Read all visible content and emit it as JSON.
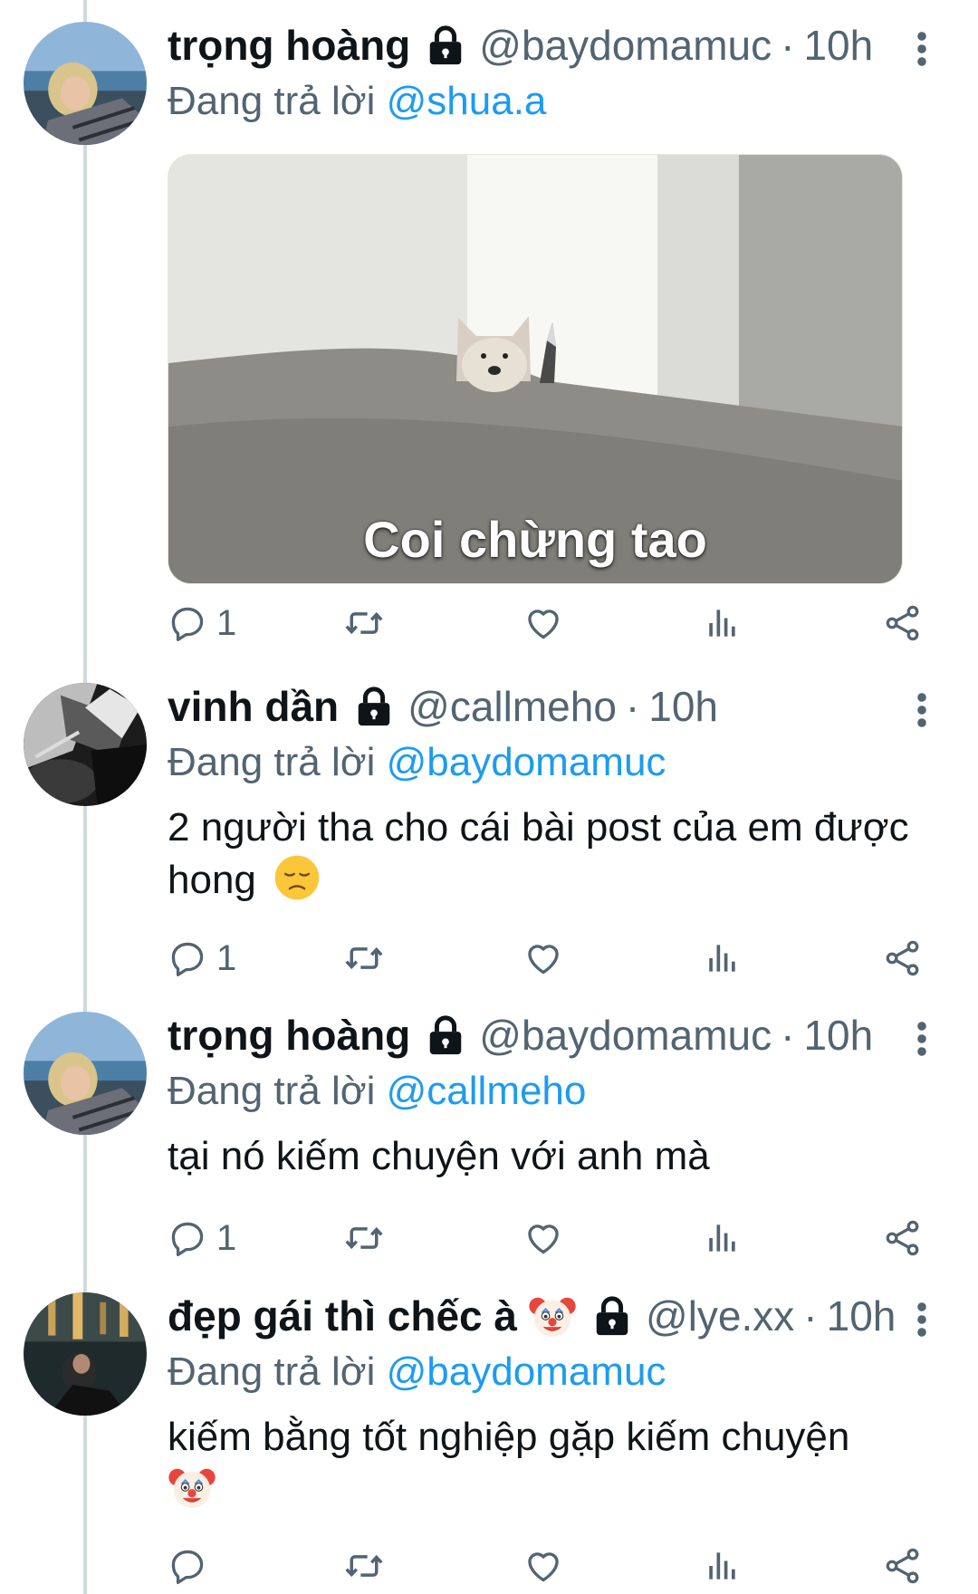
{
  "reply_prefix": "Đang trả lời",
  "colors": {
    "link": "#1d9bf0",
    "secondary": "#536471",
    "text": "#0f1419",
    "thread_line": "#cfd9de"
  },
  "tweets": [
    {
      "name": "trọng hoàng",
      "handle": "@baydomamuc",
      "separator": "·",
      "time": "10h",
      "replying_to": "@shua.a",
      "media_caption": "Coi chừng tao",
      "reply_count": "1",
      "avatar": "avatar-blonde-person-seaside"
    },
    {
      "name": "vinh dần",
      "handle": "@callmeho",
      "separator": "·",
      "time": "10h",
      "replying_to": "@baydomamuc",
      "text": "2 người tha cho cái bài post của em được hong",
      "text_emoji": "disappointed-face-emoji",
      "reply_count": "1",
      "avatar": "avatar-black-white-photo"
    },
    {
      "name": "trọng hoàng",
      "handle": "@baydomamuc",
      "separator": "·",
      "time": "10h",
      "replying_to": "@callmeho",
      "text": "tại nó kiếm chuyện với anh mà",
      "reply_count": "1",
      "avatar": "avatar-blonde-person-seaside"
    },
    {
      "name": "đẹp gái thì chếc à",
      "name_emoji": "clown-face-emoji",
      "handle": "@lye.xx",
      "separator": "·",
      "time": "10h",
      "replying_to": "@baydomamuc",
      "text": "kiếm bằng tốt nghiệp gặp kiếm chuyện",
      "text_emoji": "clown-face-emoji",
      "reply_count": "",
      "avatar": "avatar-person-night-city"
    }
  ]
}
